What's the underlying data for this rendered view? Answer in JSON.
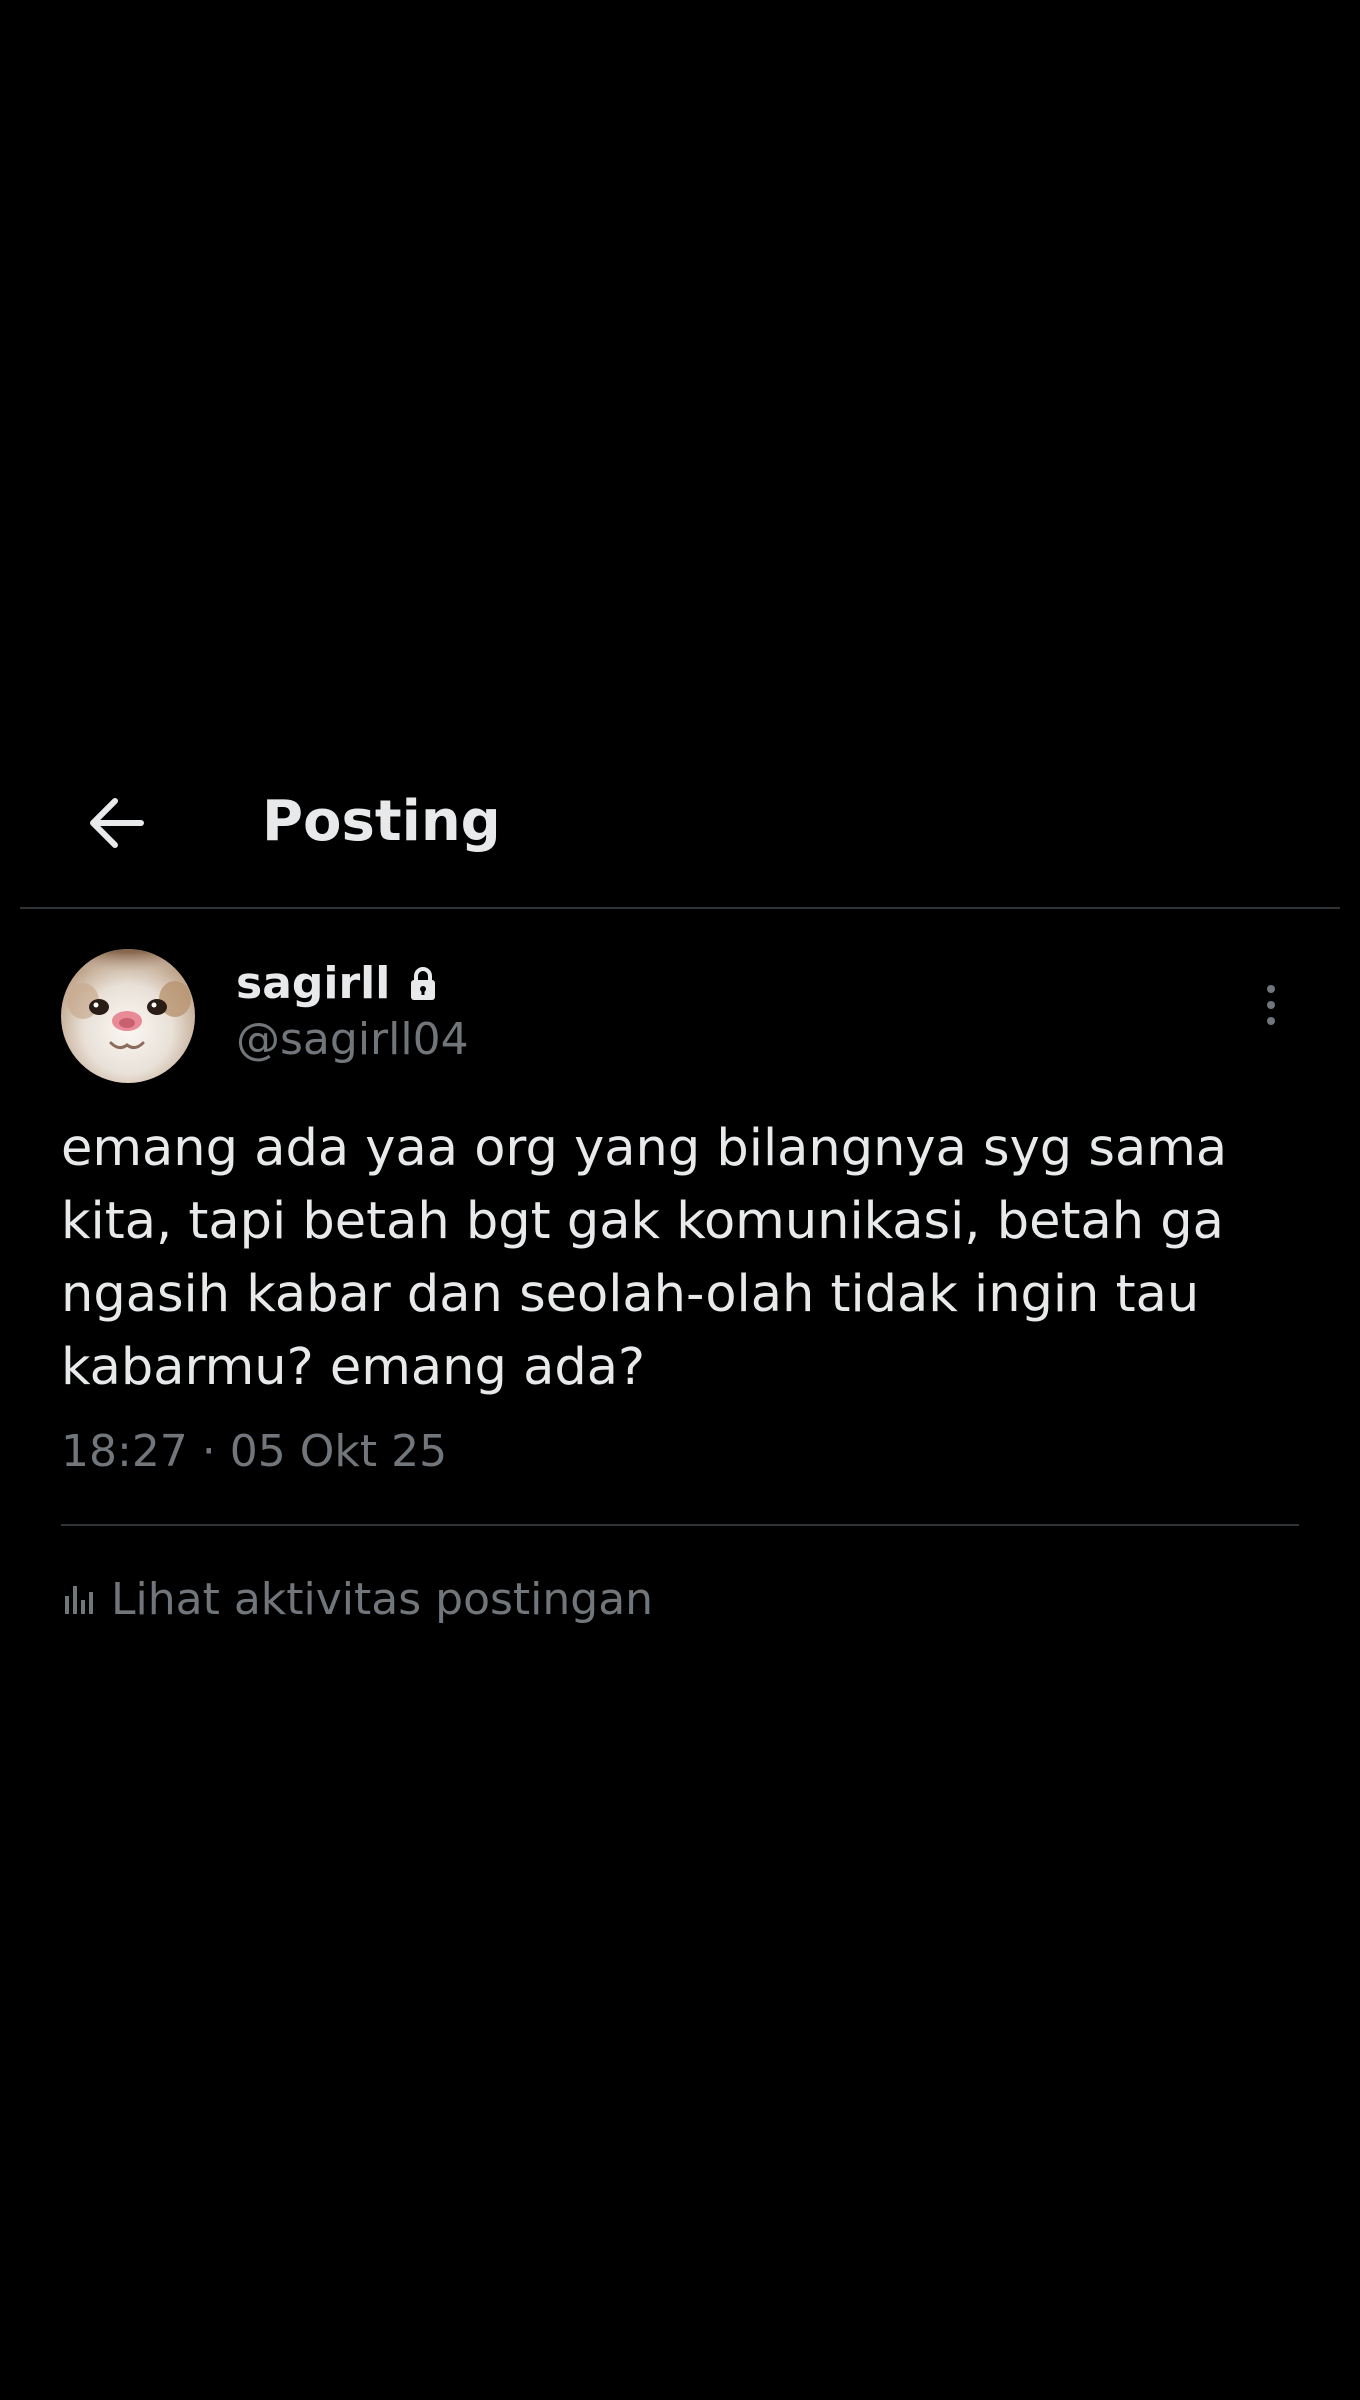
{
  "header": {
    "title": "Posting",
    "back_icon": "arrow-left-icon"
  },
  "post": {
    "author": {
      "display_name": "sagirll",
      "handle": "@sagirll04",
      "protected_icon": "lock-icon",
      "avatar": "cat-face-avatar"
    },
    "text": "emang ada yaa org yang bilangnya syg sama kita, tapi betah bgt gak komunikasi, betah ga ngasih kabar dan seolah-olah tidak ingin tau kabarmu? emang ada?",
    "timestamp": "18:27 · 05 Okt 25",
    "more_icon": "more-vertical-icon"
  },
  "activity": {
    "icon": "bar-chart-icon",
    "label": "Lihat aktivitas postingan"
  },
  "colors": {
    "background": "#000000",
    "primary_text": "#e7e9ea",
    "secondary_text": "#71767b",
    "divider": "#2f3336"
  }
}
